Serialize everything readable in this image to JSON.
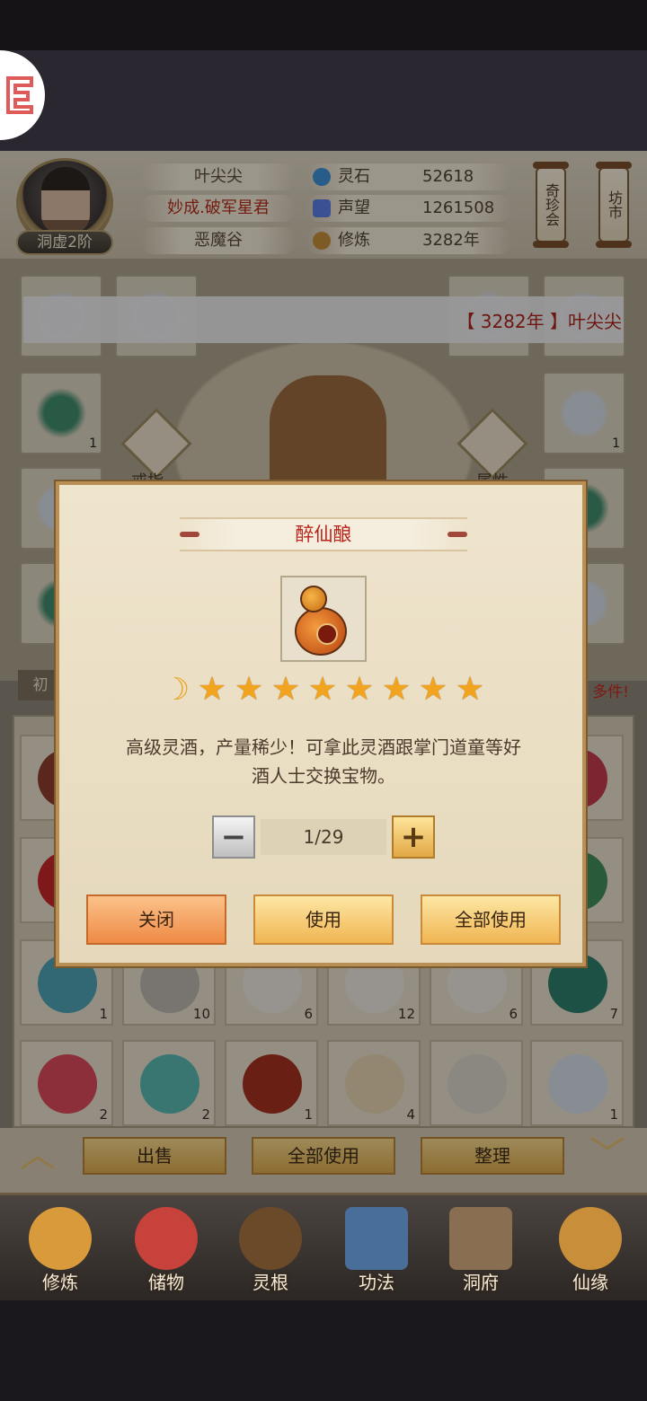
{
  "header": {
    "player_name": "叶尖尖",
    "title": "妙成.破军星君",
    "sect": "恶魔谷",
    "realm": "洞虚2阶",
    "stats": [
      {
        "label": "灵石",
        "value": "52618",
        "icon": "spirit-stone-icon",
        "color": "#3d8fd1"
      },
      {
        "label": "声望",
        "value": "1261508",
        "icon": "reputation-icon",
        "color": "#5a7be0"
      },
      {
        "label": "修炼",
        "value": "3282年",
        "icon": "cultivation-icon",
        "color": "#c28a3a"
      }
    ],
    "side_buttons": [
      {
        "label": "奇珍会"
      },
      {
        "label": "坊市"
      }
    ]
  },
  "equipment": {
    "left_label": "戒指",
    "right_label": "属性",
    "slot_count": "1"
  },
  "broadcast": "【 3282年 】叶尖尖",
  "inventory": {
    "tab_label": "初",
    "hint": "多件!",
    "counts": [
      "1",
      "10",
      "6",
      "12",
      "6",
      "7",
      "2",
      "2",
      "1",
      "4",
      "1"
    ],
    "buttons": {
      "sell": "出售",
      "use_all": "全部使用",
      "sort": "整理"
    }
  },
  "nav": {
    "items": [
      {
        "label": "修炼",
        "icon": "cultivation-nav-icon",
        "color": "#d99a3c"
      },
      {
        "label": "储物",
        "icon": "storage-bag-icon",
        "color": "#c6423a"
      },
      {
        "label": "灵根",
        "icon": "spirit-root-icon",
        "color": "#6b4a2a"
      },
      {
        "label": "功法",
        "icon": "technique-book-icon",
        "color": "#4a6e9a"
      },
      {
        "label": "洞府",
        "icon": "cave-house-icon",
        "color": "#8a6e52"
      },
      {
        "label": "仙缘",
        "icon": "immortal-fate-icon",
        "color": "#c98e3a"
      }
    ]
  },
  "modal": {
    "title": "醉仙酿",
    "item_icon": "wine-gourd-icon",
    "star_count": 8,
    "description_line1": "高级灵酒，产量稀少！可拿此灵酒跟掌门道童等好",
    "description_line2": "酒人士交换宝物。",
    "quantity": "1/29",
    "buttons": {
      "close": "关闭",
      "use": "使用",
      "use_all": "全部使用"
    }
  }
}
